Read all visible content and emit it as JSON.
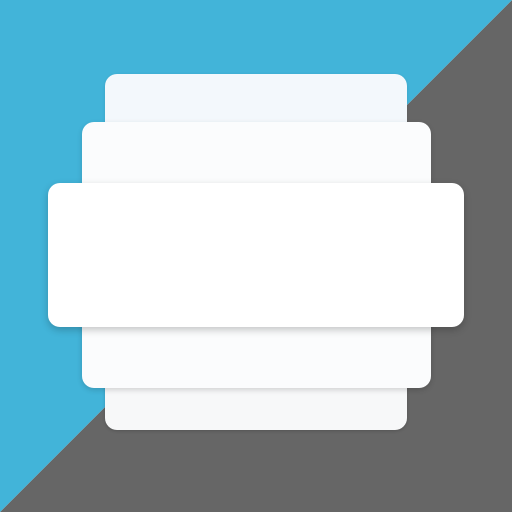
{
  "colors": {
    "primary": "#42b4d9",
    "secondary": "#666666",
    "card": "#ffffff"
  },
  "icons": [
    "stacked-cards-icon"
  ]
}
